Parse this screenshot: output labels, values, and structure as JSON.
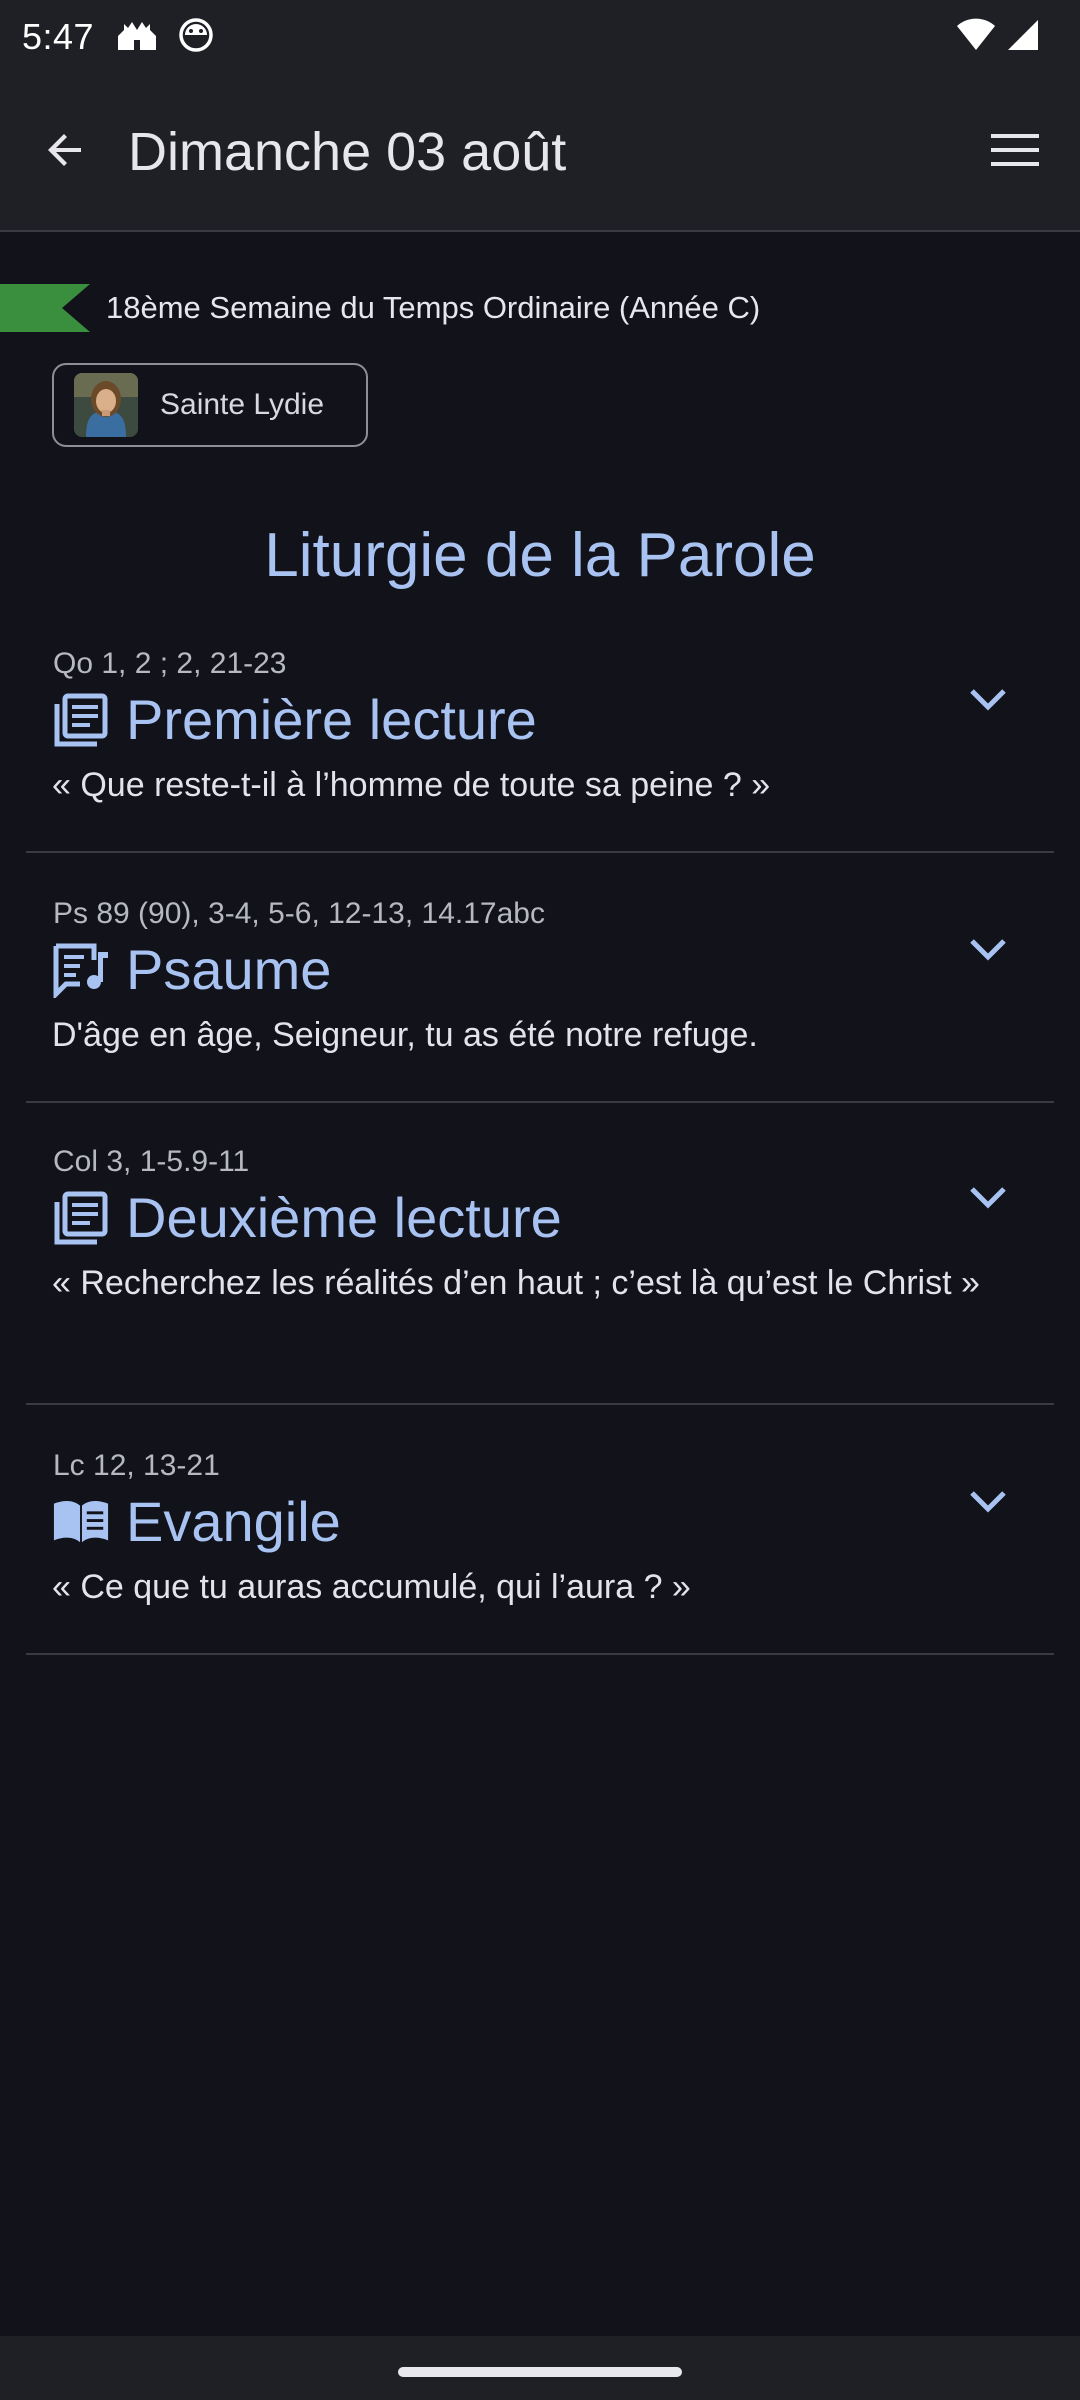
{
  "status_bar": {
    "time": "5:47",
    "left_icons": [
      "castle-icon",
      "android-robot-icon"
    ],
    "right_icons": [
      "wifi-icon",
      "cell-signal-icon"
    ]
  },
  "app_bar": {
    "title": "Dimanche 03 août",
    "back_icon": "arrow-back-icon",
    "menu_icon": "hamburger-menu-icon"
  },
  "week": {
    "label": "18ème Semaine du Temps Ordinaire (Année C)",
    "color": "#3a8f3e"
  },
  "saint": {
    "name": "Sainte Lydie"
  },
  "section_title": "Liturgie de la Parole",
  "readings": [
    {
      "ref": "Qo 1, 2 ; 2, 21-23",
      "title": "Première lecture",
      "subtitle": "« Que reste-t-il à l’homme de toute sa peine ? »",
      "icon": "book-lines-icon"
    },
    {
      "ref": "Ps 89 (90), 3-4, 5-6, 12-13, 14.17abc",
      "title": "Psaume",
      "subtitle": "D'âge en âge, Seigneur, tu as été notre refuge.",
      "icon": "lyrics-music-icon"
    },
    {
      "ref": "Col 3, 1-5.9-11",
      "title": "Deuxième lecture",
      "subtitle": "« Recherchez les réalités d’en haut ; c’est là qu’est le Christ »",
      "icon": "book-lines-icon"
    },
    {
      "ref": "Lc 12, 13-21",
      "title": "Evangile",
      "subtitle": "« Ce que tu auras accumulé, qui l’aura ? »",
      "icon": "open-book-icon"
    }
  ],
  "colors": {
    "accent": "#a8c2f2",
    "background": "#12131a",
    "bar": "#1f2026"
  }
}
